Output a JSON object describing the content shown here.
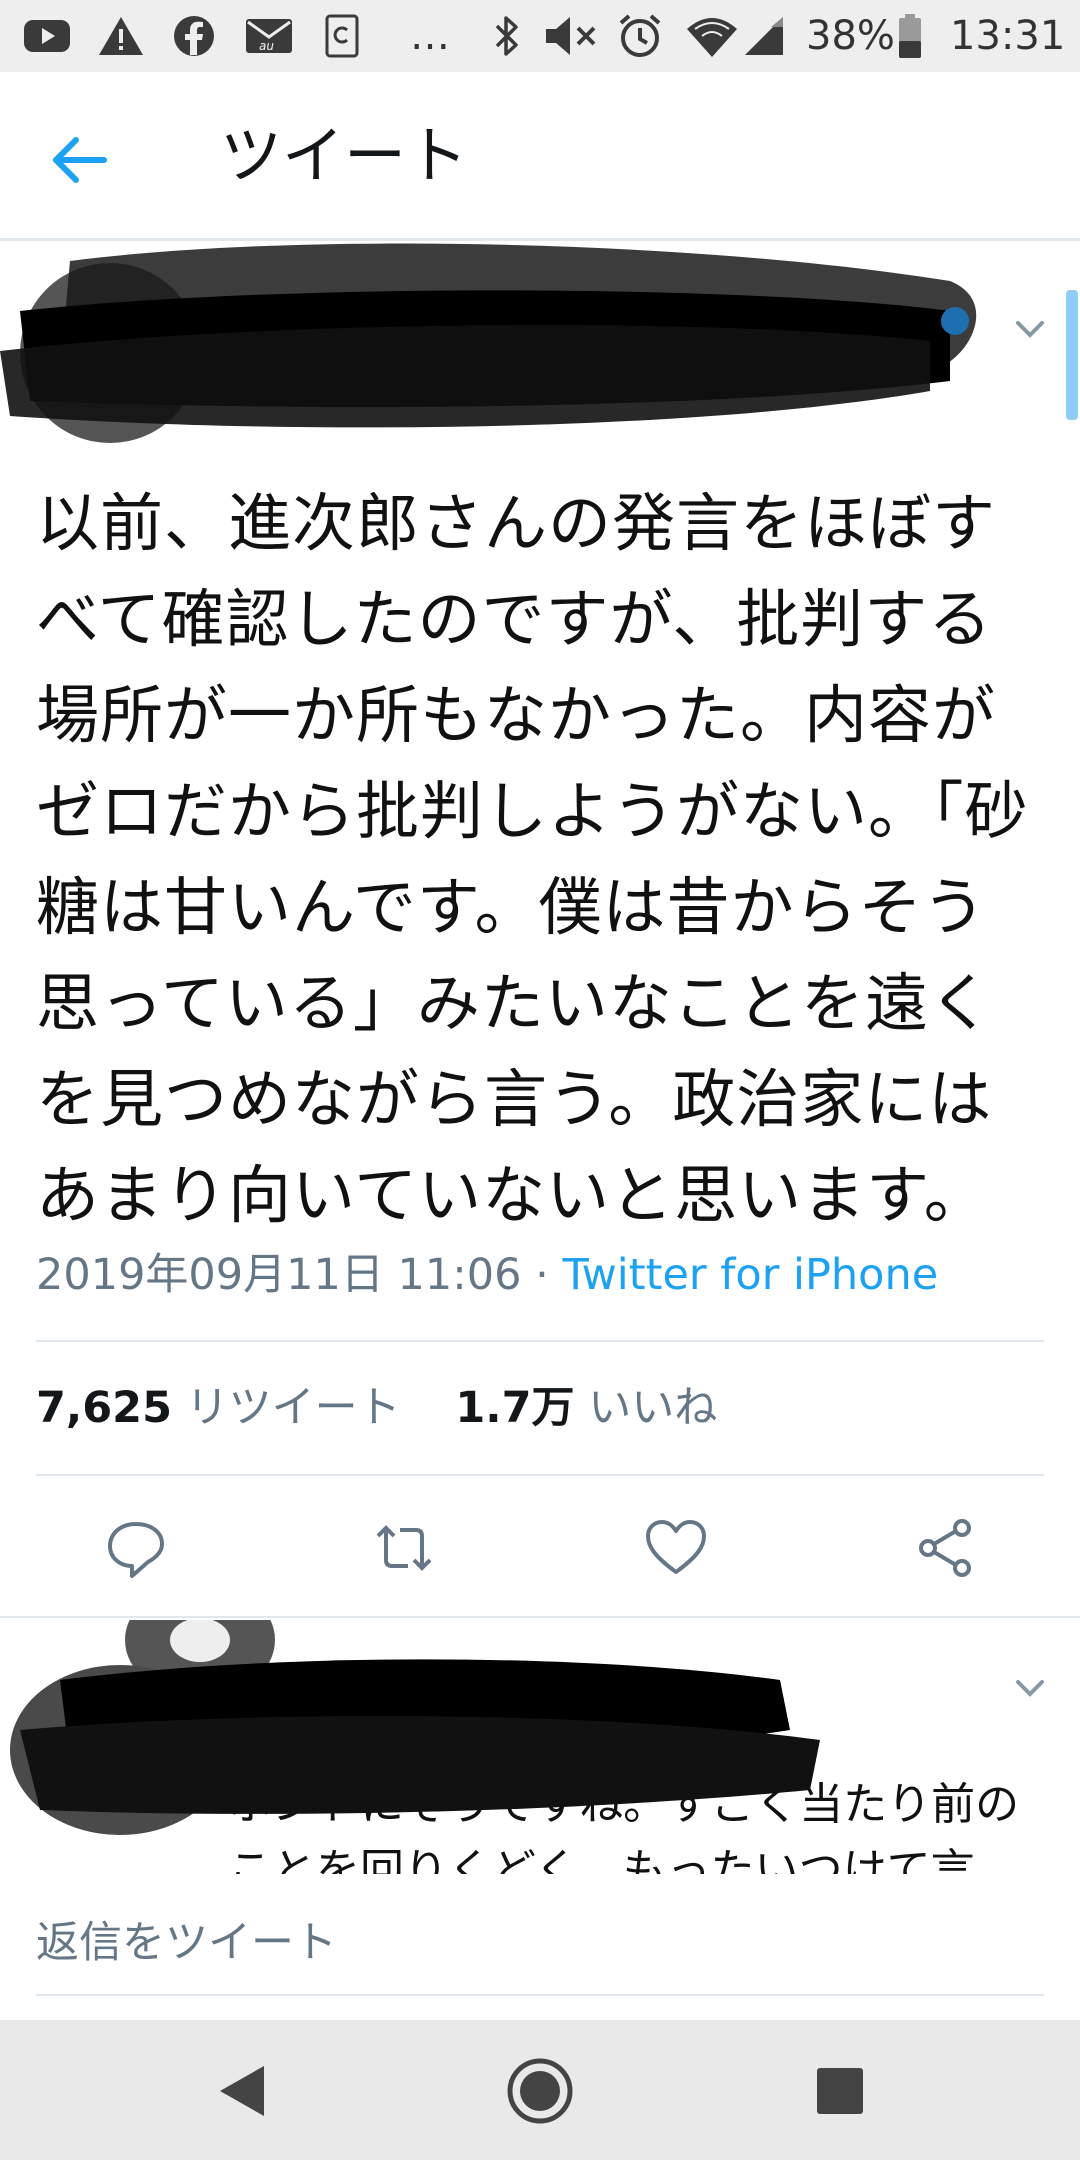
{
  "status_bar": {
    "battery": "38%",
    "time": "13:31",
    "more": "…",
    "icons": [
      "youtube-icon",
      "warning-icon",
      "facebook-icon",
      "au-mail-icon",
      "clipboard-icon",
      "bluetooth-icon",
      "mute-icon",
      "alarm-icon",
      "wifi-icon",
      "signal-icon",
      "battery-icon"
    ]
  },
  "header": {
    "back_icon": "arrow-left-icon",
    "title": "ツイート"
  },
  "tweet": {
    "text": "以前、進次郎さんの発言をほぼすべて確認したのですが、批判する場所が一か所もなかった。内容がゼロだから批判しようがない。「砂糖は甘いんです。僕は昔からそう思っている」みたいなことを遠くを見つめながら言う。政治家にはあまり向いていないと思います。",
    "timestamp": "2019年09月11日 11:06",
    "separator": "·",
    "source": "Twitter for iPhone",
    "retweets": "7,625",
    "retweets_label": "リツイート",
    "likes": "1.7万",
    "likes_label": "いいね"
  },
  "actions": [
    "reply-icon",
    "retweet-icon",
    "like-icon",
    "share-icon"
  ],
  "reply": {
    "text": "ホントにそうですね。すごく当たり前のことを回りくどく、もったいつけて言"
  },
  "composer": {
    "placeholder": "返信をツイート"
  },
  "nav": [
    "back-triangle-icon",
    "home-circle-icon",
    "recents-square-icon"
  ],
  "colors": {
    "accent": "#1da1f2",
    "secondary_text": "#657786",
    "divider": "#e1e8ed",
    "status_bar_bg": "#eeeeee",
    "nav_bar_bg": "#e9e9e9"
  }
}
